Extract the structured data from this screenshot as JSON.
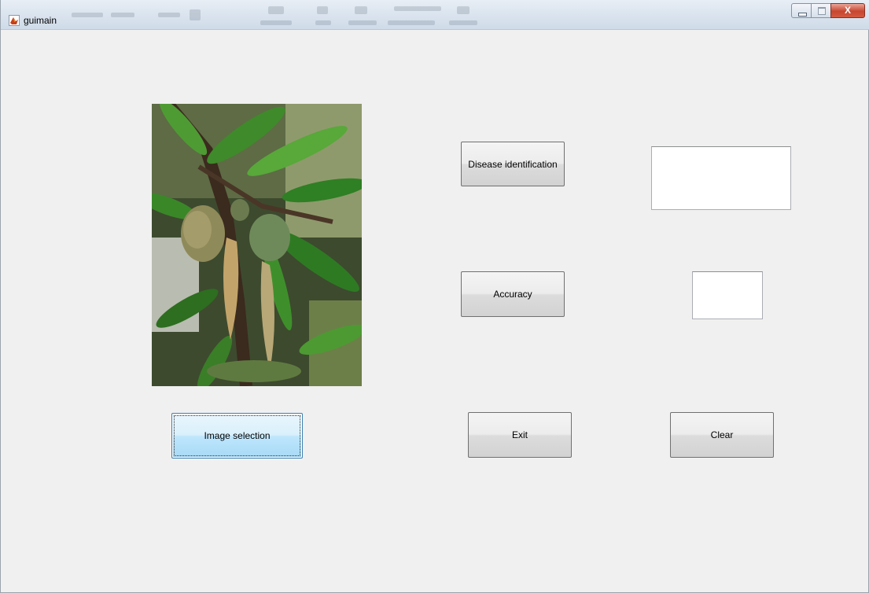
{
  "window": {
    "title": "guimain"
  },
  "buttons": {
    "disease_identification": "Disease identification",
    "accuracy": "Accuracy",
    "image_selection": "Image selection",
    "exit": "Exit",
    "clear": "Clear"
  },
  "outputs": {
    "disease_result": "",
    "accuracy_value": ""
  },
  "image": {
    "subject": "almond branch with diseased leaves and fruit"
  },
  "colors": {
    "window_background": "#f0f0f0",
    "focused_button": "#bee6fd",
    "close_button": "#c7462f"
  },
  "icons": {
    "app": "matlab-icon",
    "minimize": "minimize-icon",
    "maximize": "maximize-icon",
    "close": "close-icon"
  }
}
